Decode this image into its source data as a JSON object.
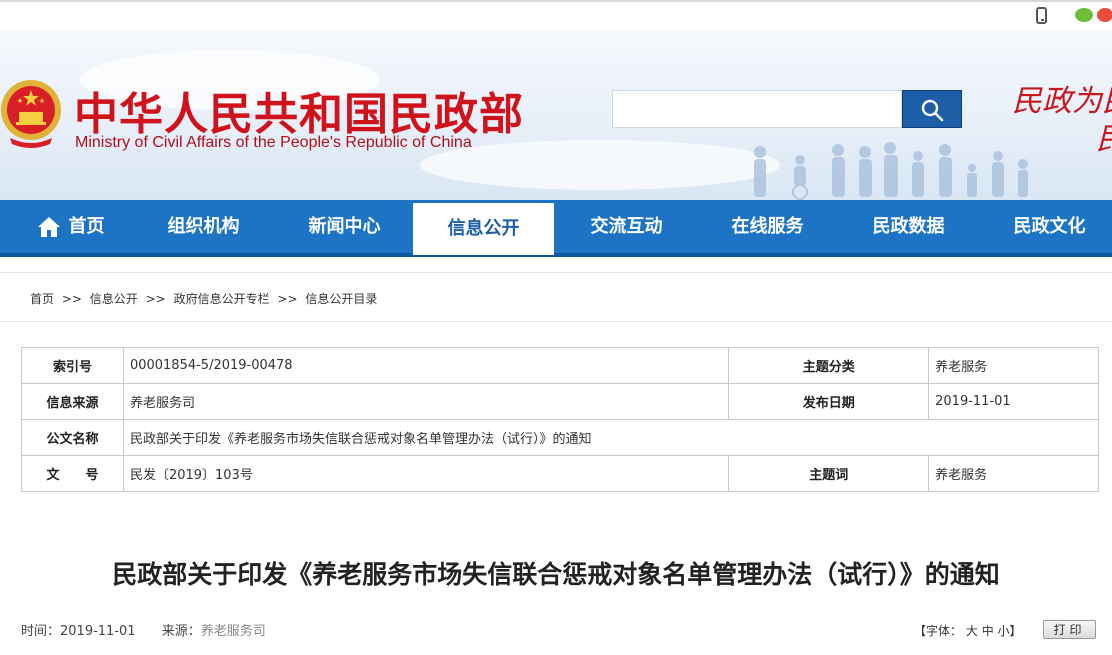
{
  "site": {
    "title_cn": "中华人民共和国民政部",
    "title_en": "Ministry of Civil Affairs of the People's Republic of China",
    "slogan_line1": "民政为民",
    "slogan_line2": "民",
    "search": {
      "placeholder": ""
    }
  },
  "nav": {
    "items": [
      {
        "label": "首页",
        "icon": "home-icon"
      },
      {
        "label": "组织机构"
      },
      {
        "label": "新闻中心"
      },
      {
        "label": "信息公开",
        "active": true
      },
      {
        "label": "交流互动"
      },
      {
        "label": "在线服务"
      },
      {
        "label": "民政数据"
      },
      {
        "label": "民政文化"
      }
    ]
  },
  "breadcrumb": [
    "首页",
    ">>",
    "信息公开",
    ">>",
    "政府信息公开专栏",
    ">>",
    "信息公开目录"
  ],
  "meta": {
    "index_label": "索引号",
    "index_value": "00001854-5/2019-00478",
    "topic_label": "主题分类",
    "topic_value": "养老服务",
    "source_label": "信息来源",
    "source_value": "养老服务司",
    "date_label": "发布日期",
    "date_value": "2019-11-01",
    "docname_label": "公文名称",
    "docname_value": "民政部关于印发《养老服务市场失信联合惩戒对象名单管理办法（试行）》的通知",
    "docnum_label": "文　　号",
    "docnum_value": "民发〔2019〕103号",
    "keyword_label": "主题词",
    "keyword_value": "养老服务"
  },
  "article": {
    "title": "民政部关于印发《养老服务市场失信联合惩戒对象名单管理办法（试行）》的通知",
    "time_label": "时间：",
    "time_value": "2019-11-01",
    "source_label": "来源：",
    "source_value": "养老服务司",
    "font_label": "【字体：",
    "font_large": "大",
    "font_medium": "中",
    "font_small": "小",
    "font_close": "】",
    "print_label": "打印"
  },
  "colors": {
    "brand_red": "#d0121b",
    "nav_blue": "#1d74c5",
    "search_blue": "#1d5ea8"
  }
}
